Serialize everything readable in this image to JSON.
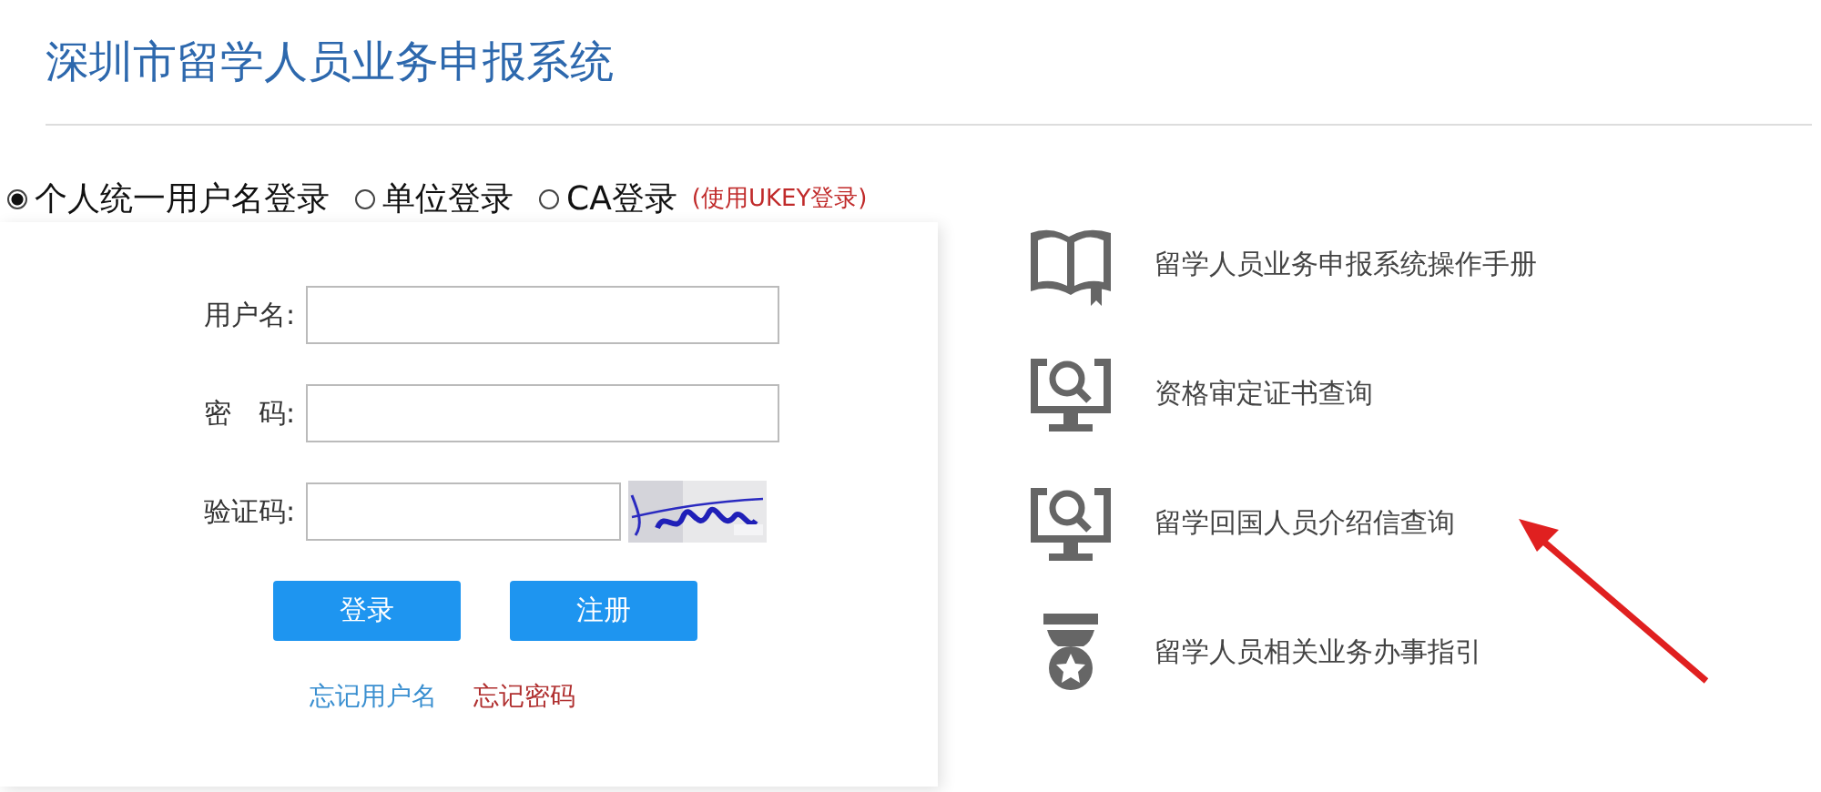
{
  "title": "深圳市留学人员业务申报系统",
  "login_types": [
    {
      "label": "个人统一用户名登录",
      "selected": true
    },
    {
      "label": "单位登录",
      "selected": false
    },
    {
      "label": "CA登录",
      "selected": false,
      "note": "(使用UKEY登录)"
    }
  ],
  "form": {
    "fields": [
      {
        "label": "用户名:",
        "kind": "text"
      },
      {
        "label": "密　码:",
        "kind": "text"
      },
      {
        "label": "验证码:",
        "kind": "captcha"
      }
    ],
    "buttons": [
      "登录",
      "注册"
    ],
    "links": [
      {
        "label": "忘记用户名",
        "color": "#3a8fd0"
      },
      {
        "label": "忘记密码",
        "color": "#b03030"
      }
    ]
  },
  "services": [
    {
      "kind": "book",
      "label": "留学人员业务申报系统操作手册"
    },
    {
      "kind": "monitor-search",
      "label": "资格审定证书查询"
    },
    {
      "kind": "monitor-search",
      "label": "留学回国人员介绍信查询"
    },
    {
      "kind": "badge",
      "label": "留学人员相关业务办事指引"
    }
  ],
  "annotation": {
    "kind": "arrow"
  }
}
